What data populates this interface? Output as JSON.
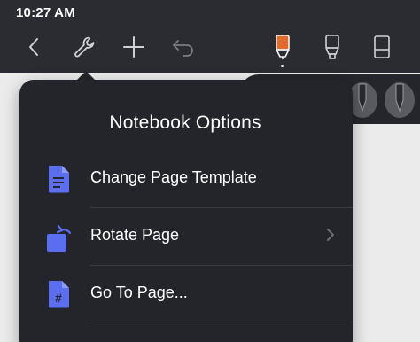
{
  "status_bar": {
    "time": "10:27 AM"
  },
  "toolbar": {
    "icons": [
      "back-chevron-icon",
      "wrench-icon",
      "plus-icon",
      "undo-icon",
      "pen-tool-icon",
      "highlighter-tool-icon",
      "eraser-tool-icon"
    ],
    "selected_tool_color": "#e26a2c"
  },
  "popover": {
    "title": "Notebook Options",
    "items": [
      {
        "label": "Change Page Template",
        "icon": "page-template-icon",
        "has_submenu": false
      },
      {
        "label": "Rotate Page",
        "icon": "rotate-page-icon",
        "has_submenu": true
      },
      {
        "label": "Go To Page...",
        "icon": "go-to-page-icon",
        "has_submenu": false
      }
    ]
  },
  "colors": {
    "chrome": "#2b2c31",
    "popover_bg": "#24252a",
    "accent_blue": "#5b6ef0",
    "canvas": "#ebebeb"
  }
}
